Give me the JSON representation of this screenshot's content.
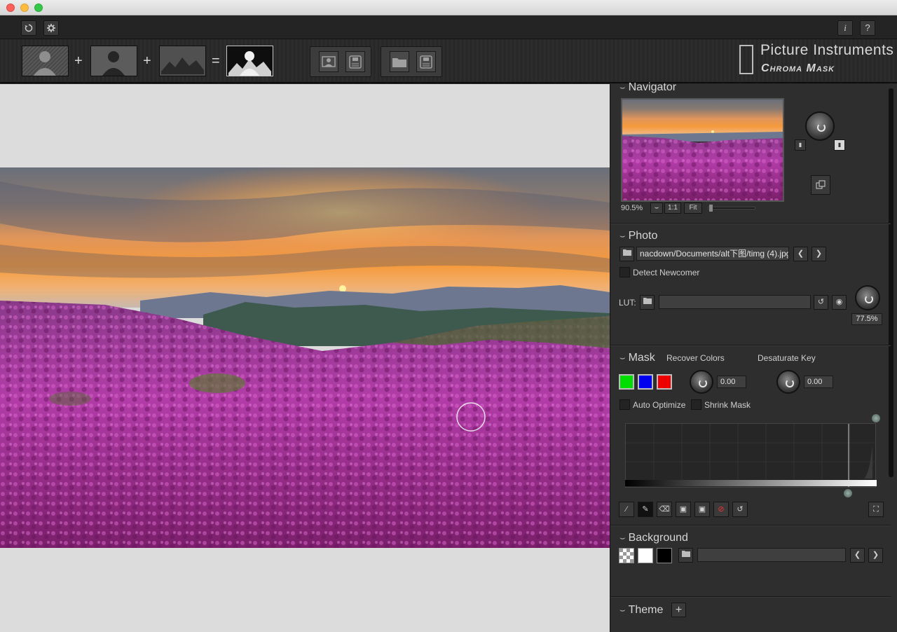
{
  "toolbar": {
    "reset_icon": "reset-icon",
    "settings_icon": "gear-icon",
    "info_label": "i",
    "help_label": "?",
    "op_plus1": "+",
    "op_plus2": "+",
    "op_equals": "="
  },
  "brand": {
    "line1": "Picture Instruments",
    "line2": "Chroma Mask"
  },
  "navigator": {
    "title": "Navigator",
    "zoom_value": "90.5%",
    "zoom_1to1": "1:1",
    "zoom_fit": "Fit"
  },
  "photo": {
    "title": "Photo",
    "path_value": "nacdown/Documents/alt下图/timg (4).jpg",
    "detect_newcomer_label": "Detect Newcomer",
    "lut_label": "LUT:",
    "lut_value": "",
    "lut_amount": "77.5%"
  },
  "mask": {
    "title": "Mask",
    "recover_colors_label": "Recover Colors",
    "recover_colors_value": "0.00",
    "desaturate_key_label": "Desaturate Key",
    "desaturate_key_value": "0.00",
    "auto_optimize_label": "Auto Optimize",
    "shrink_mask_label": "Shrink Mask",
    "key_colors": [
      "#00dd00",
      "#0000ee",
      "#ee0000"
    ]
  },
  "background": {
    "title": "Background",
    "path_value": ""
  },
  "theme": {
    "title": "Theme",
    "add_label": "+"
  },
  "colors": {
    "panel_bg": "#2e2e2e",
    "toolbar_bg": "#242424",
    "canvas_bg": "#dcdcdc"
  }
}
